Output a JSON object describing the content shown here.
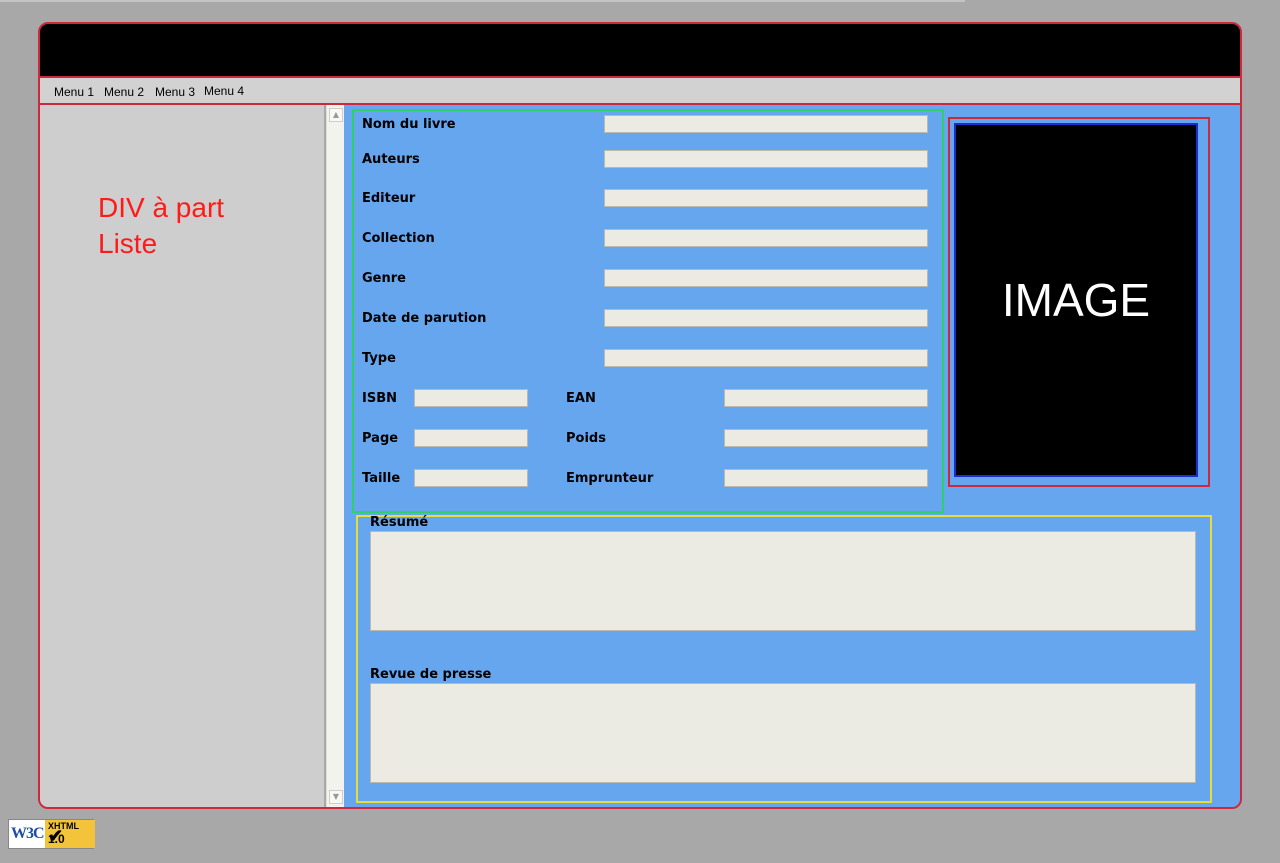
{
  "menu": {
    "items": [
      {
        "label": "Menu 1"
      },
      {
        "label": "Menu 2"
      },
      {
        "label": "Menu 3"
      },
      {
        "label": "Menu 4"
      }
    ]
  },
  "sidebar": {
    "caption_line1": "DIV à part",
    "caption_line2": "Liste"
  },
  "form": {
    "nom_du_livre": {
      "label": "Nom du livre",
      "value": ""
    },
    "auteurs": {
      "label": "Auteurs",
      "value": ""
    },
    "editeur": {
      "label": "Editeur",
      "value": ""
    },
    "collection": {
      "label": "Collection",
      "value": ""
    },
    "genre": {
      "label": "Genre",
      "value": ""
    },
    "date_de_parution": {
      "label": "Date de parution",
      "value": ""
    },
    "type": {
      "label": "Type",
      "value": ""
    },
    "isbn": {
      "label": "ISBN",
      "value": ""
    },
    "ean": {
      "label": "EAN",
      "value": ""
    },
    "page": {
      "label": "Page",
      "value": ""
    },
    "poids": {
      "label": "Poids",
      "value": ""
    },
    "taille": {
      "label": "Taille",
      "value": ""
    },
    "emprunteur": {
      "label": "Emprunteur",
      "value": ""
    }
  },
  "image": {
    "placeholder_text": "IMAGE"
  },
  "resume": {
    "label": "Résumé",
    "value": ""
  },
  "revue": {
    "label": "Revue de presse",
    "value": ""
  },
  "badge": {
    "logo": "W3C",
    "line1": "XHTML",
    "line2": "1.0",
    "check": "✔"
  },
  "scrollbar": {
    "up_glyph": "▲",
    "down_glyph": "▼"
  }
}
